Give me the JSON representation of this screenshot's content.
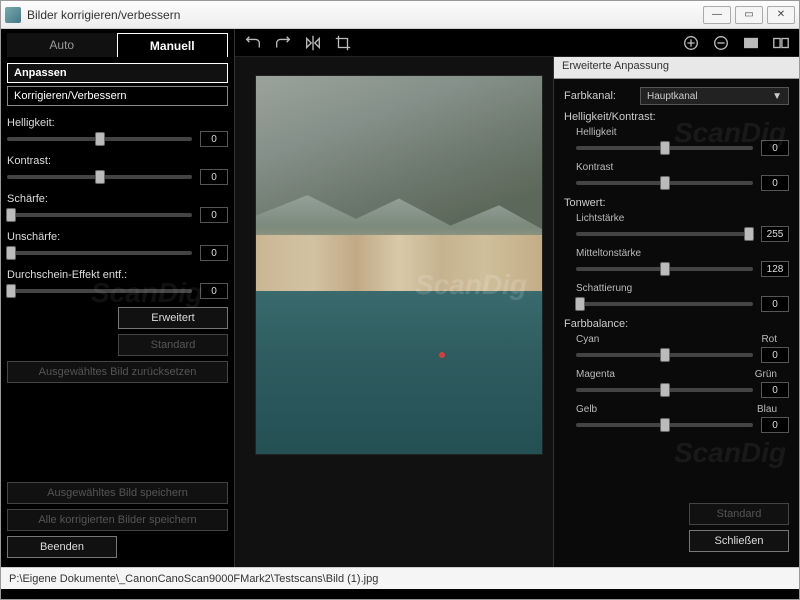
{
  "window": {
    "title": "Bilder korrigieren/verbessern"
  },
  "tabs": {
    "auto": "Auto",
    "manual": "Manuell"
  },
  "subtabs": {
    "adjust": "Anpassen",
    "correct": "Korrigieren/Verbessern"
  },
  "sliders": {
    "brightness": {
      "label": "Helligkeit:",
      "value": "0"
    },
    "contrast": {
      "label": "Kontrast:",
      "value": "0"
    },
    "sharpness": {
      "label": "Schärfe:",
      "value": "0"
    },
    "blur": {
      "label": "Unschärfe:",
      "value": "0"
    },
    "showthrough": {
      "label": "Durchschein-Effekt entf.:",
      "value": "0"
    }
  },
  "buttons": {
    "extended": "Erweitert",
    "standard": "Standard",
    "reset_selected": "Ausgewähltes Bild zurücksetzen",
    "save_selected": "Ausgewähltes Bild speichern",
    "save_all": "Alle korrigierten Bilder speichern",
    "exit": "Beenden"
  },
  "adv": {
    "title": "Erweiterte Anpassung",
    "channel_label": "Farbkanal:",
    "channel_value": "Hauptkanal",
    "brightcontrast": "Helligkeit/Kontrast:",
    "brightness": "Helligkeit",
    "brightness_value": "0",
    "contrast": "Kontrast",
    "contrast_value": "0",
    "tones": "Tonwert:",
    "highlights": "Lichtstärke",
    "highlights_value": "255",
    "midtones": "Mitteltonstärke",
    "midtones_value": "128",
    "shadows": "Schattierung",
    "shadows_value": "0",
    "colorbalance": "Farbbalance:",
    "cyan": "Cyan",
    "red": "Rot",
    "cr_value": "0",
    "magenta": "Magenta",
    "green": "Grün",
    "mg_value": "0",
    "yellow": "Gelb",
    "blue": "Blau",
    "yb_value": "0",
    "standard": "Standard",
    "close": "Schließen"
  },
  "status": {
    "path": "P:\\Eigene Dokumente\\_CanonCanoScan9000FMark2\\Testscans\\Bild (1).jpg"
  },
  "watermark": "ScanDig"
}
